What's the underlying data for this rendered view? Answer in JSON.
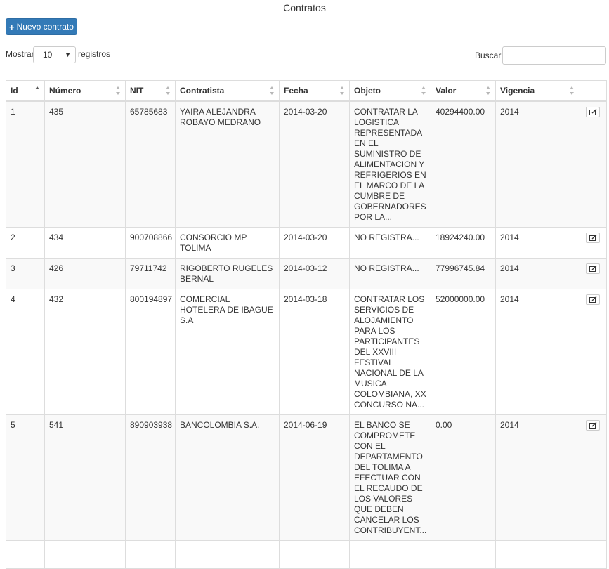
{
  "page": {
    "title": "Contratos"
  },
  "toolbar": {
    "new_contract_label": "Nuevo contrato",
    "new_contract_icon": "plus-icon"
  },
  "length": {
    "prefix": "Mostrar",
    "value": "10",
    "suffix": "registros"
  },
  "search": {
    "label": "Buscar:",
    "value": "",
    "placeholder": ""
  },
  "table": {
    "columns": [
      "Id",
      "Número",
      "NIT",
      "Contratista",
      "Fecha",
      "Objeto",
      "Valor",
      "Vigencia",
      ""
    ],
    "sorted_column": "Id",
    "sort_direction": "asc",
    "rows": [
      {
        "id": "1",
        "numero": "435",
        "nit": "65785683",
        "contratista": "YAIRA ALEJANDRA ROBAYO MEDRANO",
        "fecha": "2014-03-20",
        "objeto": "CONTRATAR LA LOGISTICA REPRESENTADA EN EL SUMINISTRO DE ALIMENTACION Y REFRIGERIOS EN EL MARCO DE LA CUMBRE DE GOBERNADORES POR LA...",
        "valor": "40294400.00",
        "vigencia": "2014"
      },
      {
        "id": "2",
        "numero": "434",
        "nit": "900708866",
        "contratista": "CONSORCIO MP TOLIMA",
        "fecha": "2014-03-20",
        "objeto": "NO REGISTRA...",
        "valor": "18924240.00",
        "vigencia": "2014"
      },
      {
        "id": "3",
        "numero": "426",
        "nit": "79711742",
        "contratista": "RIGOBERTO RUGELES BERNAL",
        "fecha": "2014-03-12",
        "objeto": "NO REGISTRA...",
        "valor": "77996745.84",
        "vigencia": "2014"
      },
      {
        "id": "4",
        "numero": "432",
        "nit": "800194897",
        "contratista": "COMERCIAL HOTELERA DE IBAGUE S.A",
        "fecha": "2014-03-18",
        "objeto": "CONTRATAR LOS SERVICIOS DE ALOJAMIENTO PARA LOS PARTICIPANTES DEL XXVIII FESTIVAL NACIONAL DE LA MUSICA COLOMBIANA, XX CONCURSO NA...",
        "valor": "52000000.00",
        "vigencia": "2014"
      },
      {
        "id": "5",
        "numero": "541",
        "nit": "890903938",
        "contratista": "BANCOLOMBIA S.A.",
        "fecha": "2014-06-19",
        "objeto": "EL BANCO SE COMPROMETE CON EL DEPARTAMENTO DEL TOLIMA A EFECTUAR CON EL RECAUDO DE LOS VALORES QUE DEBEN CANCELAR LOS CONTRIBUYENT...",
        "valor": "0.00",
        "vigencia": "2014"
      },
      {
        "id": "",
        "numero": "",
        "nit": "",
        "contratista": "",
        "fecha": "",
        "objeto": "",
        "valor": "",
        "vigencia": ""
      }
    ],
    "row_action_icon": "edit-icon"
  }
}
